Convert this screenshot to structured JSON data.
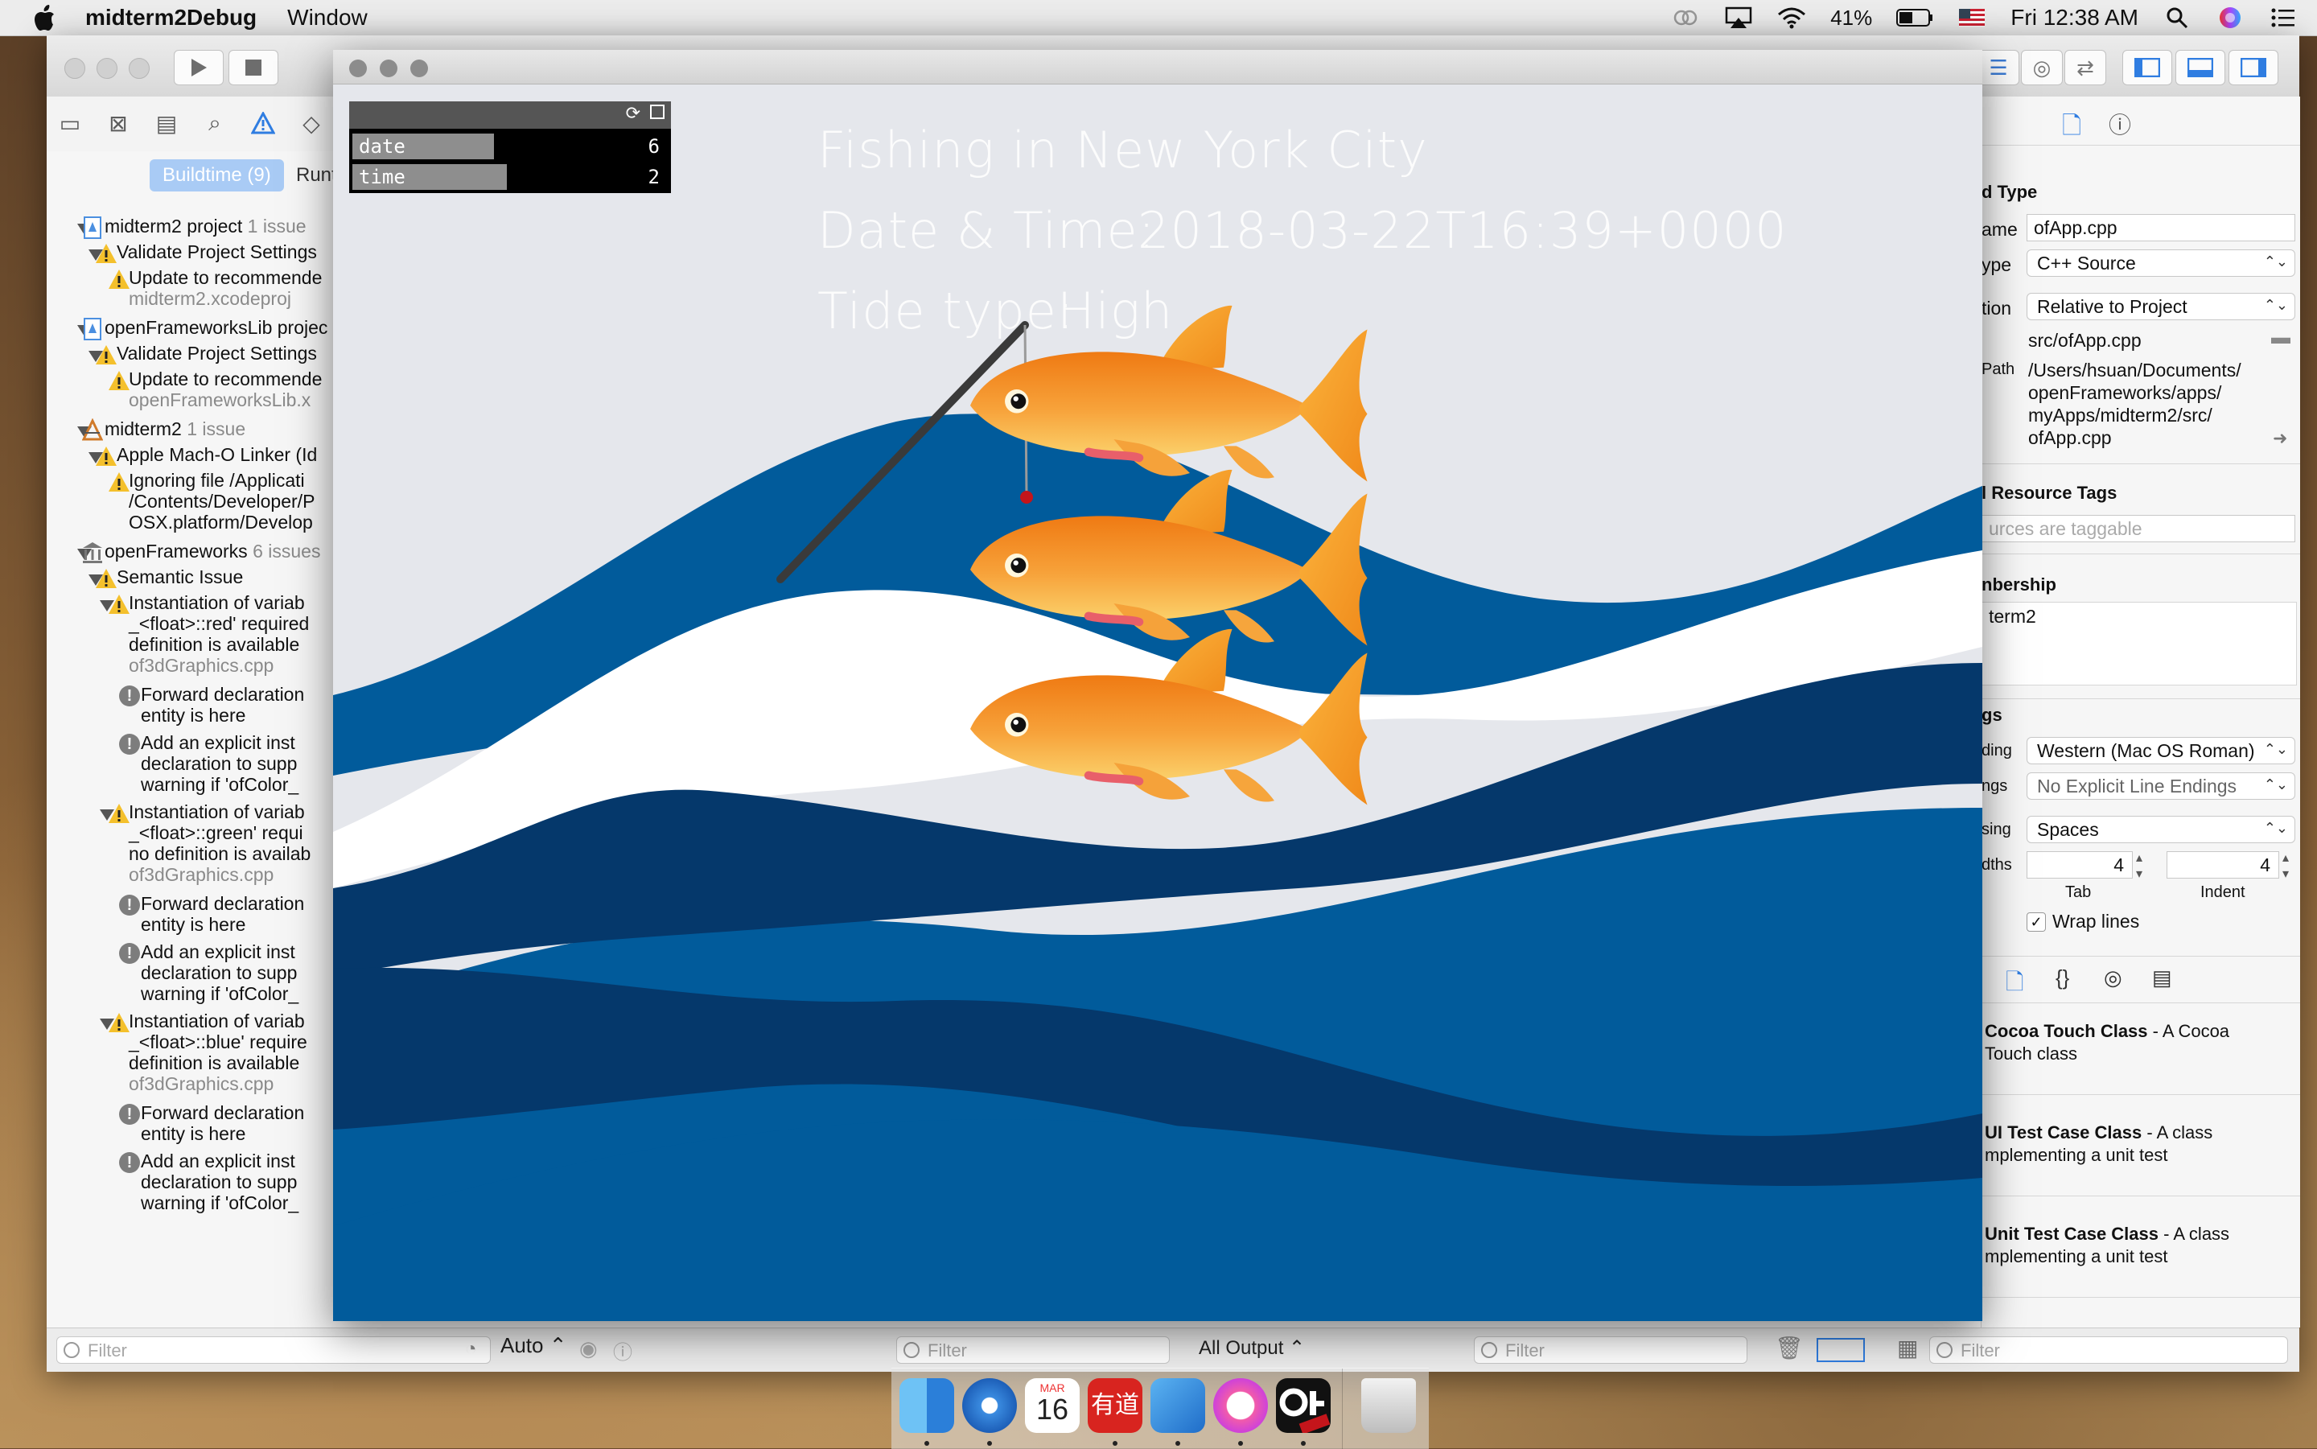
{
  "menubar": {
    "app_name": "midterm2Debug",
    "menus": [
      "Window"
    ],
    "battery_percent": "41%",
    "clock": "Fri 12:38 AM",
    "icons": [
      "apple-logo",
      "creative-cloud-icon",
      "airplay-icon",
      "wifi-icon",
      "battery-icon",
      "flag-us-icon",
      "spotlight-icon",
      "siri-icon",
      "notification-center-icon"
    ]
  },
  "navigator": {
    "scope_buildtime": "Buildtime (9)",
    "scope_runtime": "Runt",
    "filter_placeholder": "Filter",
    "issues": [
      {
        "text": "midterm2 project",
        "count": "1 issue"
      },
      {
        "text": "Validate Project Settings"
      },
      {
        "text": "Update to recommende"
      },
      {
        "text": "midterm2.xcodeproj"
      },
      {
        "text": "openFrameworksLib projec"
      },
      {
        "text": "Validate Project Settings"
      },
      {
        "text": "Update to recommende"
      },
      {
        "text": "openFrameworksLib.x"
      },
      {
        "text": "midterm2",
        "count": "1 issue"
      },
      {
        "text": "Apple Mach-O Linker (Id"
      },
      {
        "text": "Ignoring file /Applicati"
      },
      {
        "text": "/Contents/Developer/P"
      },
      {
        "text": "OSX.platform/Develop"
      },
      {
        "text": "openFrameworks",
        "count": "6 issues"
      },
      {
        "text": "Semantic Issue"
      },
      {
        "text": "Instantiation of variab"
      },
      {
        "text": "_<float>::red' required"
      },
      {
        "text": "definition is available"
      },
      {
        "text": "of3dGraphics.cpp"
      },
      {
        "text": "Forward declaration"
      },
      {
        "text": "entity is here"
      },
      {
        "text": "Add an explicit inst"
      },
      {
        "text": "declaration to supp"
      },
      {
        "text": "warning if 'ofColor_"
      },
      {
        "text": "Instantiation of variab"
      },
      {
        "text": "_<float>::green' requi"
      },
      {
        "text": "no definition is availab"
      },
      {
        "text": "of3dGraphics.cpp"
      },
      {
        "text": "Forward declaration"
      },
      {
        "text": "entity is here"
      },
      {
        "text": "Add an explicit inst"
      },
      {
        "text": "declaration to supp"
      },
      {
        "text": "warning if 'ofColor_"
      },
      {
        "text": "Instantiation of variab"
      },
      {
        "text": "_<float>::blue' require"
      },
      {
        "text": "definition is available"
      },
      {
        "text": "of3dGraphics.cpp"
      },
      {
        "text": "Forward declaration"
      },
      {
        "text": "entity is here"
      },
      {
        "text": "Add an explicit inst"
      },
      {
        "text": "declaration to supp"
      },
      {
        "text": "warning if 'ofColor_"
      }
    ]
  },
  "debug_bar": {
    "auto_label": "Auto",
    "filter_placeholder": "Filter",
    "output_label": "All Output"
  },
  "inspector": {
    "type_header": "d Type",
    "name_label": "ame",
    "name_value": "ofApp.cpp",
    "type_label": "ype",
    "type_value": "C++ Source",
    "location_label": "tion",
    "location_value": "Relative to Project",
    "relative_path": "src/ofApp.cpp",
    "full_path_label": "Path",
    "full_path": [
      "/Users/hsuan/Documents/",
      "openFrameworks/apps/",
      "myApps/midterm2/src/",
      "ofApp.cpp"
    ],
    "tags_header": "l Resource Tags",
    "tags_placeholder": "urces are taggable",
    "membership_header": "nbership",
    "membership_value": "term2",
    "settings_header": "gs",
    "encoding_label": "ding",
    "encoding_value": "Western (Mac OS Roman)",
    "endings_label": "ngs",
    "endings_value": "No Explicit Line Endings",
    "indent_label": "sing",
    "indent_value": "Spaces",
    "widths_label": "dths",
    "tab_width": "4",
    "indent_width": "4",
    "tab_caption": "Tab",
    "indent_caption": "Indent",
    "wrap_lines": "Wrap lines",
    "library": [
      {
        "title": "Cocoa Touch Class",
        "desc1": " - A Cocoa",
        "desc2": "Touch class"
      },
      {
        "title": "UI Test Case Class",
        "desc1": " - A class",
        "desc2": "mplementing a unit test"
      },
      {
        "title": "Unit Test Case Class",
        "desc1": " - A class",
        "desc2": "mplementing a unit test"
      }
    ],
    "filter_placeholder": "Filter"
  },
  "app": {
    "title_line": "Fishing in New York City",
    "datetime_label": "Date & Time:",
    "datetime_value": "2018-03-22T16:39+0000",
    "tide_label": "Tide type:",
    "tide_value": "High",
    "gui": {
      "rows": [
        {
          "label": "date",
          "value": "6",
          "fill": 0.45
        },
        {
          "label": "time",
          "value": "2",
          "fill": 0.49
        }
      ]
    },
    "colors": {
      "wave_mid": "#015b9b",
      "wave_dark": "#05386b",
      "wave_light": "#ffffff",
      "background": "#e5e7ec",
      "fish": "#f5901e"
    }
  },
  "dock": {
    "apps": [
      "finder-icon",
      "safari-icon",
      "calendar-icon",
      "youdao-icon",
      "xcode-icon",
      "itunes-icon",
      "openframeworks-debug-icon",
      "trash-icon"
    ],
    "calendar_month": "MAR",
    "calendar_day": "16",
    "youdao_label": "有道"
  }
}
